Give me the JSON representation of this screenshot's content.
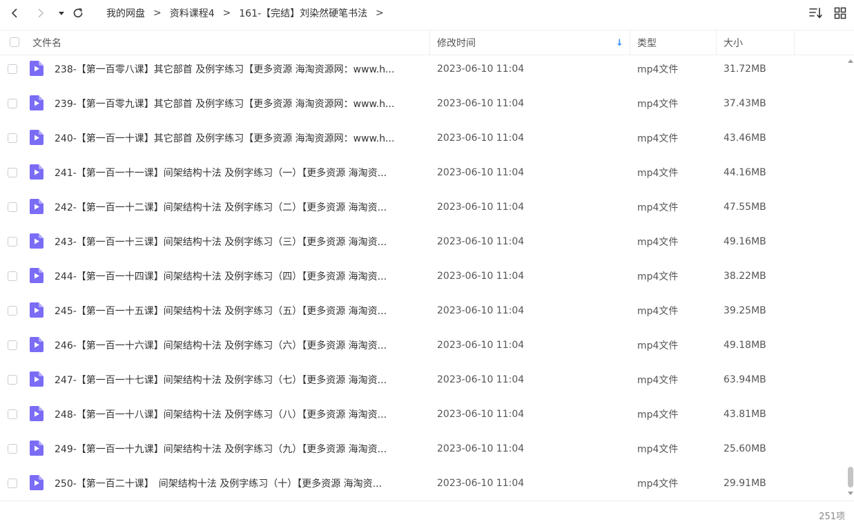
{
  "toolbar": {
    "breadcrumb": [
      "我的网盘",
      "资料课程4",
      "161-【完结】刘染然硬笔书法"
    ],
    "separator": ">",
    "icons": [
      "back-icon",
      "forward-icon",
      "dropdown-icon",
      "refresh-icon",
      "sort-icon",
      "grid-view-icon"
    ]
  },
  "table": {
    "headers": {
      "name": "文件名",
      "modified": "修改时间",
      "type": "类型",
      "size": "大小"
    },
    "sort_indicator": "↓",
    "rows": [
      {
        "name": "238-【第一百零八课】其它部首 及例字练习【更多资源 海淘资源网：www.h...",
        "modified": "2023-06-10 11:04",
        "type": "mp4文件",
        "size": "31.72MB"
      },
      {
        "name": "239-【第一百零九课】其它部首 及例字练习【更多资源 海淘资源网：www.h...",
        "modified": "2023-06-10 11:04",
        "type": "mp4文件",
        "size": "37.43MB"
      },
      {
        "name": "240-【第一百一十课】其它部首 及例字练习【更多资源 海淘资源网：www.h...",
        "modified": "2023-06-10 11:04",
        "type": "mp4文件",
        "size": "43.46MB"
      },
      {
        "name": "241-【第一百一十一课】间架结构十法 及例字练习（一）【更多资源 海淘资...",
        "modified": "2023-06-10 11:04",
        "type": "mp4文件",
        "size": "44.16MB"
      },
      {
        "name": "242-【第一百一十二课】间架结构十法 及例字练习（二）【更多资源 海淘资...",
        "modified": "2023-06-10 11:04",
        "type": "mp4文件",
        "size": "47.55MB"
      },
      {
        "name": "243-【第一百一十三课】间架结构十法 及例字练习（三）【更多资源 海淘资...",
        "modified": "2023-06-10 11:04",
        "type": "mp4文件",
        "size": "49.16MB"
      },
      {
        "name": "244-【第一百一十四课】间架结构十法 及例字练习（四）【更多资源 海淘资...",
        "modified": "2023-06-10 11:04",
        "type": "mp4文件",
        "size": "38.22MB"
      },
      {
        "name": "245-【第一百一十五课】间架结构十法 及例字练习（五）【更多资源 海淘资...",
        "modified": "2023-06-10 11:04",
        "type": "mp4文件",
        "size": "39.25MB"
      },
      {
        "name": "246-【第一百一十六课】间架结构十法 及例字练习（六）【更多资源 海淘资...",
        "modified": "2023-06-10 11:04",
        "type": "mp4文件",
        "size": "49.18MB"
      },
      {
        "name": "247-【第一百一十七课】间架结构十法 及例字练习（七）【更多资源 海淘资...",
        "modified": "2023-06-10 11:04",
        "type": "mp4文件",
        "size": "63.94MB"
      },
      {
        "name": "248-【第一百一十八课】间架结构十法 及例字练习（八）【更多资源 海淘资...",
        "modified": "2023-06-10 11:04",
        "type": "mp4文件",
        "size": "43.81MB"
      },
      {
        "name": "249-【第一百一十九课】间架结构十法 及例字练习（九）【更多资源 海淘资...",
        "modified": "2023-06-10 11:04",
        "type": "mp4文件",
        "size": "25.60MB"
      },
      {
        "name": "250-【第一百二十课】　间架结构十法 及例字练习（十）【更多资源 海淘资...",
        "modified": "2023-06-10 11:04",
        "type": "mp4文件",
        "size": "29.91MB"
      }
    ]
  },
  "footer": {
    "count": "251项"
  },
  "colors": {
    "file_icon": "#7b6cf6",
    "accent": "#2e8bff"
  }
}
